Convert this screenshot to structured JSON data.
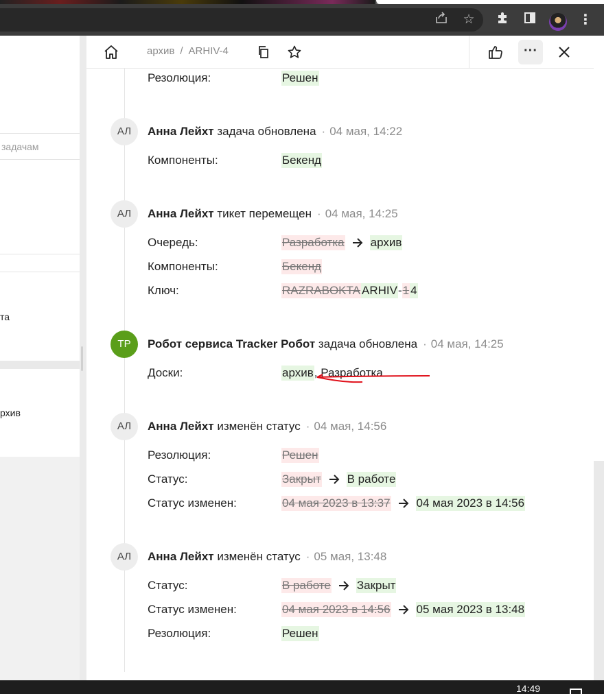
{
  "browser": {
    "icons": [
      "share-icon",
      "star-icon",
      "extensions-icon",
      "side-panel-icon",
      "profile-avatar",
      "menu-kebab-icon"
    ]
  },
  "background_app": {
    "search_placeholder_fragment": "задачам",
    "item1_fragment": "та",
    "item2_fragment": "рхив"
  },
  "header": {
    "queue": "архив",
    "separator": "/",
    "issue_key": "ARHIV-4",
    "more_label": "···"
  },
  "entries": [
    {
      "rows": [
        {
          "label": "Резолюция:",
          "parts": [
            {
              "kind": "new",
              "text": "Решен"
            }
          ]
        }
      ]
    },
    {
      "avatar": "АЛ",
      "author": "Анна Лейхт",
      "action": "задача обновлена",
      "time": "04 мая, 14:22",
      "rows": [
        {
          "label": "Компоненты:",
          "parts": [
            {
              "kind": "new",
              "text": "Бекенд"
            }
          ]
        }
      ]
    },
    {
      "avatar": "АЛ",
      "author": "Анна Лейхт",
      "action": "тикет перемещен",
      "time": "04 мая, 14:25",
      "rows": [
        {
          "label": "Очередь:",
          "parts": [
            {
              "kind": "old",
              "text": "Разработка"
            },
            {
              "kind": "arrow"
            },
            {
              "kind": "new",
              "text": "архив"
            }
          ]
        },
        {
          "label": "Компоненты:",
          "parts": [
            {
              "kind": "old",
              "text": "Бекенд"
            }
          ]
        },
        {
          "label": "Ключ:",
          "parts": [
            {
              "kind": "old",
              "text": "RAZRABOKTA"
            },
            {
              "kind": "new",
              "text": "ARHIV"
            },
            {
              "kind": "plain",
              "text": "-"
            },
            {
              "kind": "old",
              "text": "1"
            },
            {
              "kind": "new",
              "text": "4"
            }
          ]
        }
      ]
    },
    {
      "avatar": "TP",
      "author": "Робот сервиса Tracker Робот",
      "action": "задача обновлена",
      "time": "04 мая, 14:25",
      "rows": [
        {
          "label": "Доски:",
          "parts": [
            {
              "kind": "new",
              "text": "архив"
            },
            {
              "kind": "plain",
              "text": ", Разработка"
            }
          ]
        }
      ]
    },
    {
      "avatar": "АЛ",
      "author": "Анна Лейхт",
      "action": "изменён статус",
      "time": "04 мая, 14:56",
      "rows": [
        {
          "label": "Резолюция:",
          "parts": [
            {
              "kind": "old",
              "text": "Решен"
            }
          ]
        },
        {
          "label": "Статус:",
          "parts": [
            {
              "kind": "old",
              "text": "Закрыт"
            },
            {
              "kind": "arrow"
            },
            {
              "kind": "new",
              "text": "В работе"
            }
          ]
        },
        {
          "label": "Статус изменен:",
          "parts": [
            {
              "kind": "old",
              "text": "04 мая 2023 в 13:37"
            },
            {
              "kind": "arrow"
            },
            {
              "kind": "new",
              "text": "04 мая 2023 в 14:56"
            }
          ]
        }
      ]
    },
    {
      "avatar": "АЛ",
      "author": "Анна Лейхт",
      "action": "изменён статус",
      "time": "05 мая, 13:48",
      "rows": [
        {
          "label": "Статус:",
          "parts": [
            {
              "kind": "old",
              "text": "В работе"
            },
            {
              "kind": "arrow"
            },
            {
              "kind": "new",
              "text": "Закрыт"
            }
          ]
        },
        {
          "label": "Статус изменен:",
          "parts": [
            {
              "kind": "old",
              "text": "04 мая 2023 в 14:56"
            },
            {
              "kind": "arrow"
            },
            {
              "kind": "new",
              "text": "05 мая 2023 в 13:48"
            }
          ]
        },
        {
          "label": "Резолюция:",
          "parts": [
            {
              "kind": "new",
              "text": "Решен"
            }
          ]
        }
      ]
    }
  ],
  "taskbar": {
    "clock": "14:49"
  },
  "colors": {
    "old_bg": "#fde9e9",
    "new_bg": "#e6f6e2",
    "robot_avatar": "#5a9e1a",
    "annotation": "#e0101a"
  }
}
